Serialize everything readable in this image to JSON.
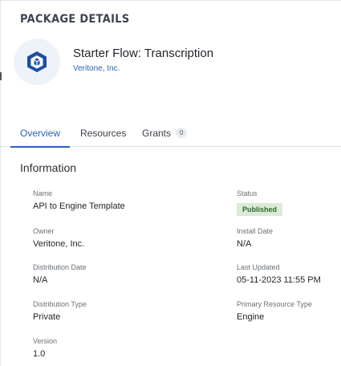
{
  "page": {
    "title": "PACKAGE DETAILS"
  },
  "package": {
    "name": "Starter Flow: Transcription",
    "org": "Veritone, Inc."
  },
  "tabs": [
    {
      "label": "Overview"
    },
    {
      "label": "Resources"
    },
    {
      "label": "Grants",
      "count": "0"
    }
  ],
  "info": {
    "title": "Information",
    "name": {
      "label": "Name",
      "value": "API to Engine Template"
    },
    "status": {
      "label": "Status",
      "value": "Published"
    },
    "owner": {
      "label": "Owner",
      "value": "Veritone, Inc."
    },
    "install_date": {
      "label": "Install Date",
      "value": "N/A"
    },
    "distribution_date": {
      "label": "Distribution Date",
      "value": "N/A"
    },
    "last_updated": {
      "label": "Last Updated",
      "value": "05-11-2023 11:55 PM"
    },
    "distribution_type": {
      "label": "Distribution Type",
      "value": "Private"
    },
    "primary_resource_type": {
      "label": "Primary Resource Type",
      "value": "Engine"
    },
    "version": {
      "label": "Version",
      "value": "1.0"
    }
  },
  "icons": {
    "package": "package-box-icon"
  },
  "colors": {
    "accent": "#2a64b8",
    "status_bg": "#dcead8",
    "status_text": "#2d6a2b"
  }
}
